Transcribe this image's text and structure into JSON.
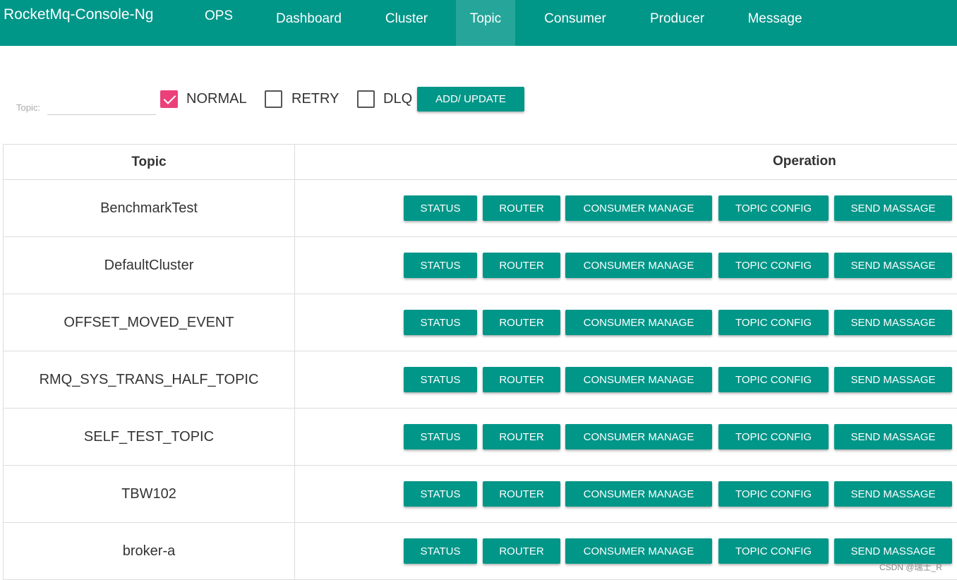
{
  "nav": {
    "brand": "RocketMq-Console-Ng",
    "items": [
      "OPS",
      "Dashboard",
      "Cluster",
      "Topic",
      "Consumer",
      "Producer",
      "Message"
    ]
  },
  "filter": {
    "topic_label": "Topic:",
    "topic_value": "",
    "normal_label": "NORMAL",
    "normal_checked": true,
    "retry_label": "RETRY",
    "retry_checked": false,
    "dlq_label": "DLQ",
    "dlq_checked": false,
    "add_update_label": "ADD/ UPDATE"
  },
  "table": {
    "headers": [
      "Topic",
      "Operation"
    ],
    "rows": [
      "BenchmarkTest",
      "DefaultCluster",
      "OFFSET_MOVED_EVENT",
      "RMQ_SYS_TRANS_HALF_TOPIC",
      "SELF_TEST_TOPIC",
      "TBW102",
      "broker-a"
    ],
    "operations": [
      "STATUS",
      "ROUTER",
      "CONSUMER MANAGE",
      "TOPIC CONFIG",
      "SEND MASSAGE"
    ]
  },
  "colors": {
    "primary": "#009688",
    "active_tab": "#26a69a",
    "checkbox_checked": "#ec407a"
  },
  "watermark": "CSDN @瑞士_R"
}
